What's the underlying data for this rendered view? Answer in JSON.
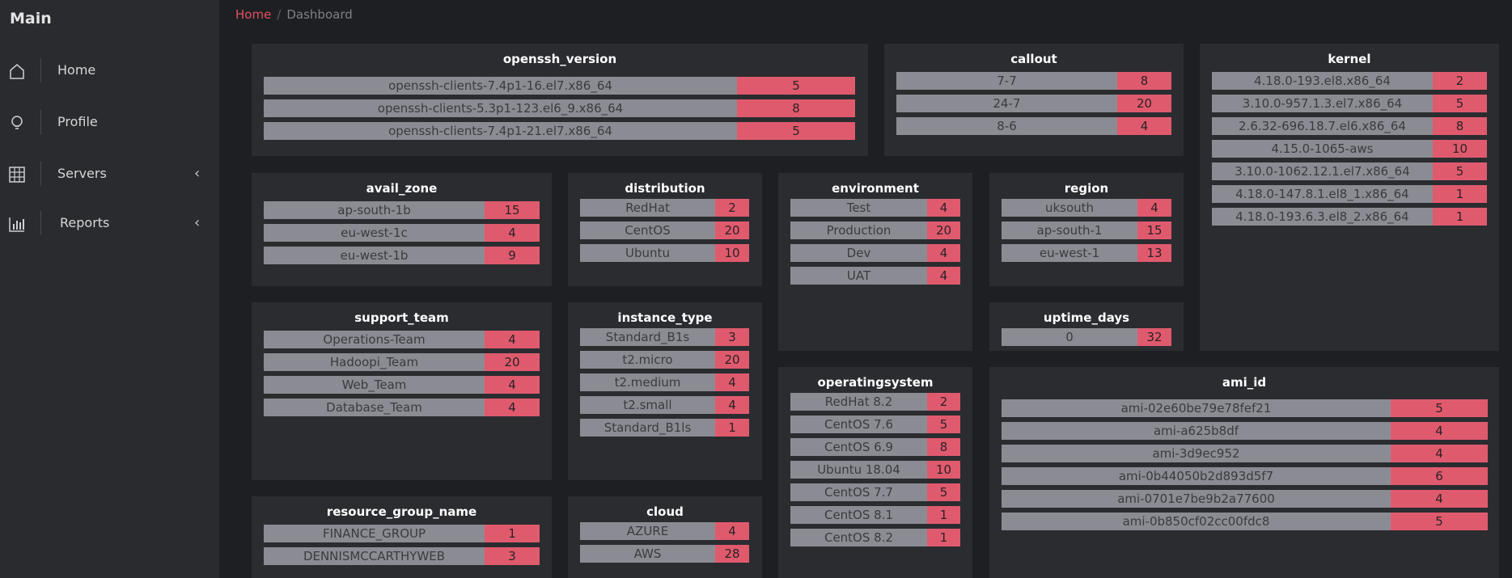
{
  "sidebar": {
    "title": "Main",
    "items": [
      {
        "label": "Home",
        "icon": "home-icon",
        "has_submenu": false
      },
      {
        "label": "Profile",
        "icon": "lightbulb-icon",
        "has_submenu": false
      },
      {
        "label": "Servers",
        "icon": "grid-icon",
        "has_submenu": true,
        "chevron": "‹"
      },
      {
        "label": "Reports",
        "icon": "bar-chart-icon",
        "has_submenu": true,
        "chevron": "‹"
      }
    ]
  },
  "breadcrumb": {
    "home": "Home",
    "separator": "/",
    "current": "Dashboard"
  },
  "colors": {
    "accent": "#e05263",
    "count_bg": "#e05a6e",
    "label_bg": "#8b8c93",
    "card_bg": "#2b2c30",
    "page_bg": "#1e1f22",
    "sidebar_bg": "#2a2b2f"
  },
  "cards": {
    "openssh_version": {
      "title": "openssh_version",
      "rows": [
        {
          "label": "openssh-clients-7.4p1-16.el7.x86_64",
          "count": "5"
        },
        {
          "label": "openssh-clients-5.3p1-123.el6_9.x86_64",
          "count": "8"
        },
        {
          "label": "openssh-clients-7.4p1-21.el7.x86_64",
          "count": "5"
        }
      ]
    },
    "callout": {
      "title": "callout",
      "rows": [
        {
          "label": "7-7",
          "count": "8"
        },
        {
          "label": "24-7",
          "count": "20"
        },
        {
          "label": "8-6",
          "count": "4"
        }
      ]
    },
    "kernel": {
      "title": "kernel",
      "rows": [
        {
          "label": "4.18.0-193.el8.x86_64",
          "count": "2"
        },
        {
          "label": "3.10.0-957.1.3.el7.x86_64",
          "count": "5"
        },
        {
          "label": "2.6.32-696.18.7.el6.x86_64",
          "count": "8"
        },
        {
          "label": "4.15.0-1065-aws",
          "count": "10"
        },
        {
          "label": "3.10.0-1062.12.1.el7.x86_64",
          "count": "5"
        },
        {
          "label": "4.18.0-147.8.1.el8_1.x86_64",
          "count": "1"
        },
        {
          "label": "4.18.0-193.6.3.el8_2.x86_64",
          "count": "1"
        }
      ]
    },
    "avail_zone": {
      "title": "avail_zone",
      "rows": [
        {
          "label": "ap-south-1b",
          "count": "15"
        },
        {
          "label": "eu-west-1c",
          "count": "4"
        },
        {
          "label": "eu-west-1b",
          "count": "9"
        }
      ]
    },
    "distribution": {
      "title": "distribution",
      "rows": [
        {
          "label": "RedHat",
          "count": "2"
        },
        {
          "label": "CentOS",
          "count": "20"
        },
        {
          "label": "Ubuntu",
          "count": "10"
        }
      ]
    },
    "environment": {
      "title": "environment",
      "rows": [
        {
          "label": "Test",
          "count": "4"
        },
        {
          "label": "Production",
          "count": "20"
        },
        {
          "label": "Dev",
          "count": "4"
        },
        {
          "label": "UAT",
          "count": "4"
        }
      ]
    },
    "region": {
      "title": "region",
      "rows": [
        {
          "label": "uksouth",
          "count": "4"
        },
        {
          "label": "ap-south-1",
          "count": "15"
        },
        {
          "label": "eu-west-1",
          "count": "13"
        }
      ]
    },
    "support_team": {
      "title": "support_team",
      "rows": [
        {
          "label": "Operations-Team",
          "count": "4"
        },
        {
          "label": "Hadoopi_Team",
          "count": "20"
        },
        {
          "label": "Web_Team",
          "count": "4"
        },
        {
          "label": "Database_Team",
          "count": "4"
        }
      ]
    },
    "instance_type": {
      "title": "instance_type",
      "rows": [
        {
          "label": "Standard_B1s",
          "count": "3"
        },
        {
          "label": "t2.micro",
          "count": "20"
        },
        {
          "label": "t2.medium",
          "count": "4"
        },
        {
          "label": "t2.small",
          "count": "4"
        },
        {
          "label": "Standard_B1ls",
          "count": "1"
        }
      ]
    },
    "uptime_days": {
      "title": "uptime_days",
      "rows": [
        {
          "label": "0",
          "count": "32"
        }
      ]
    },
    "operatingsystem": {
      "title": "operatingsystem",
      "rows": [
        {
          "label": "RedHat 8.2",
          "count": "2"
        },
        {
          "label": "CentOS 7.6",
          "count": "5"
        },
        {
          "label": "CentOS 6.9",
          "count": "8"
        },
        {
          "label": "Ubuntu 18.04",
          "count": "10"
        },
        {
          "label": "CentOS 7.7",
          "count": "5"
        },
        {
          "label": "CentOS 8.1",
          "count": "1"
        },
        {
          "label": "CentOS 8.2",
          "count": "1"
        }
      ]
    },
    "ami_id": {
      "title": "ami_id",
      "rows": [
        {
          "label": "ami-02e60be79e78fef21",
          "count": "5"
        },
        {
          "label": "ami-a625b8df",
          "count": "4"
        },
        {
          "label": "ami-3d9ec952",
          "count": "4"
        },
        {
          "label": "ami-0b44050b2d893d5f7",
          "count": "6"
        },
        {
          "label": "ami-0701e7be9b2a77600",
          "count": "4"
        },
        {
          "label": "ami-0b850cf02cc00fdc8",
          "count": "5"
        }
      ]
    },
    "resource_group_name": {
      "title": "resource_group_name",
      "rows": [
        {
          "label": "FINANCE_GROUP",
          "count": "1"
        },
        {
          "label": "DENNISMCCARTHYWEB",
          "count": "3"
        }
      ]
    },
    "cloud": {
      "title": "cloud",
      "rows": [
        {
          "label": "AZURE",
          "count": "4"
        },
        {
          "label": "AWS",
          "count": "28"
        }
      ]
    }
  }
}
